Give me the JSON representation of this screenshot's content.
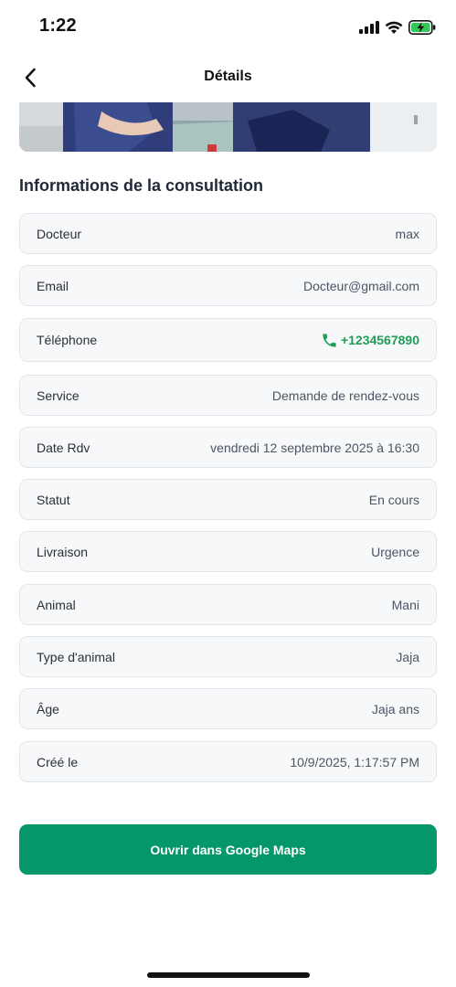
{
  "status_bar": {
    "time": "1:22",
    "icons": [
      "signal-icon",
      "wifi-icon",
      "battery-charging-icon"
    ]
  },
  "nav": {
    "title": "Détails",
    "back_icon": "chevron-left-icon"
  },
  "section": {
    "title": "Informations de la consultation"
  },
  "rows": [
    {
      "label": "Docteur",
      "value": "max"
    },
    {
      "label": "Email",
      "value": "Docteur@gmail.com"
    },
    {
      "label": "Téléphone",
      "value": "+1234567890"
    },
    {
      "label": "Service",
      "value": "Demande de rendez-vous"
    },
    {
      "label": "Date Rdv",
      "value": "vendredi 12 septembre 2025 à 16:30"
    },
    {
      "label": "Statut",
      "value": "En cours"
    },
    {
      "label": "Livraison",
      "value": "Urgence"
    },
    {
      "label": "Animal",
      "value": "Mani"
    },
    {
      "label": "Type d'animal",
      "value": "Jaja"
    },
    {
      "label": "Âge",
      "value": "Jaja ans"
    },
    {
      "label": "Créé le",
      "value": "10/9/2025, 1:17:57 PM"
    }
  ],
  "actions": {
    "maps_label": "Ouvrir dans Google Maps"
  },
  "colors": {
    "accent": "#059669",
    "phone": "#1f9d55",
    "row_bg": "#f7f8fa"
  }
}
